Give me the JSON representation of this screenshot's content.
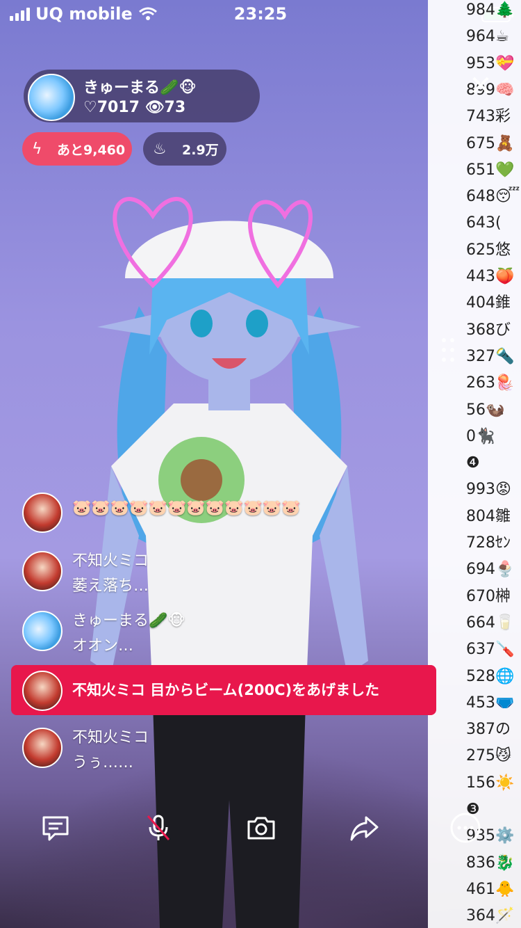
{
  "status_bar": {
    "carrier": "UQ mobile",
    "time": "23:25"
  },
  "host": {
    "name": "きゅーまる🥒🐵",
    "hearts": "♡7017",
    "viewers": "👁73"
  },
  "goal_pill": {
    "icon": "lightning-icon",
    "text": "あと9,460"
  },
  "fire_pill": {
    "icon": "flame-icon",
    "text": "2.9万"
  },
  "ranking": [
    "984🌲",
    "964☕",
    "953💝",
    "899🧠",
    "743彩",
    "675🧸",
    "651💚",
    "648😴",
    "643(",
    "625悠",
    "443🍑",
    "404錐",
    "368び",
    "327🔦",
    "263🪼",
    "56🦦",
    "0🐈‍⬛",
    "❹",
    "993😡",
    "804雛",
    "728ｾﾝ",
    "694🍨",
    "670榊",
    "664🥛",
    "637🪛",
    "528🌐",
    "453🩲",
    "387の",
    "275😼",
    "156☀️",
    "❸",
    "935⚙️",
    "836🐉",
    "461🐥",
    "364🪄"
  ],
  "chat": [
    {
      "name": "",
      "text": "🐷🐷🐷🐷🐷🐷🐷🐷🐷🐷🐷🐷",
      "avatar": "red"
    },
    {
      "name": "不知火ミコ",
      "text": "萎え落ち…",
      "avatar": "red"
    },
    {
      "name": "きゅーまる🥒🐵",
      "text": "オオン…",
      "avatar": "blue"
    },
    {
      "gift": "不知火ミコ 目からビーム(200C)をあげました",
      "avatar": "red"
    },
    {
      "name": "不知火ミコ",
      "text": "うぅ……",
      "avatar": "red"
    }
  ],
  "toolbar": {
    "comment": "comment-icon",
    "mic": "mic-muted-icon",
    "camera": "camera-icon",
    "share": "share-icon",
    "more": "more-icon"
  },
  "colors": {
    "gift_banner": "#e8174c",
    "goal_pill": "#ef4b6a",
    "battery": "#4ade80"
  }
}
